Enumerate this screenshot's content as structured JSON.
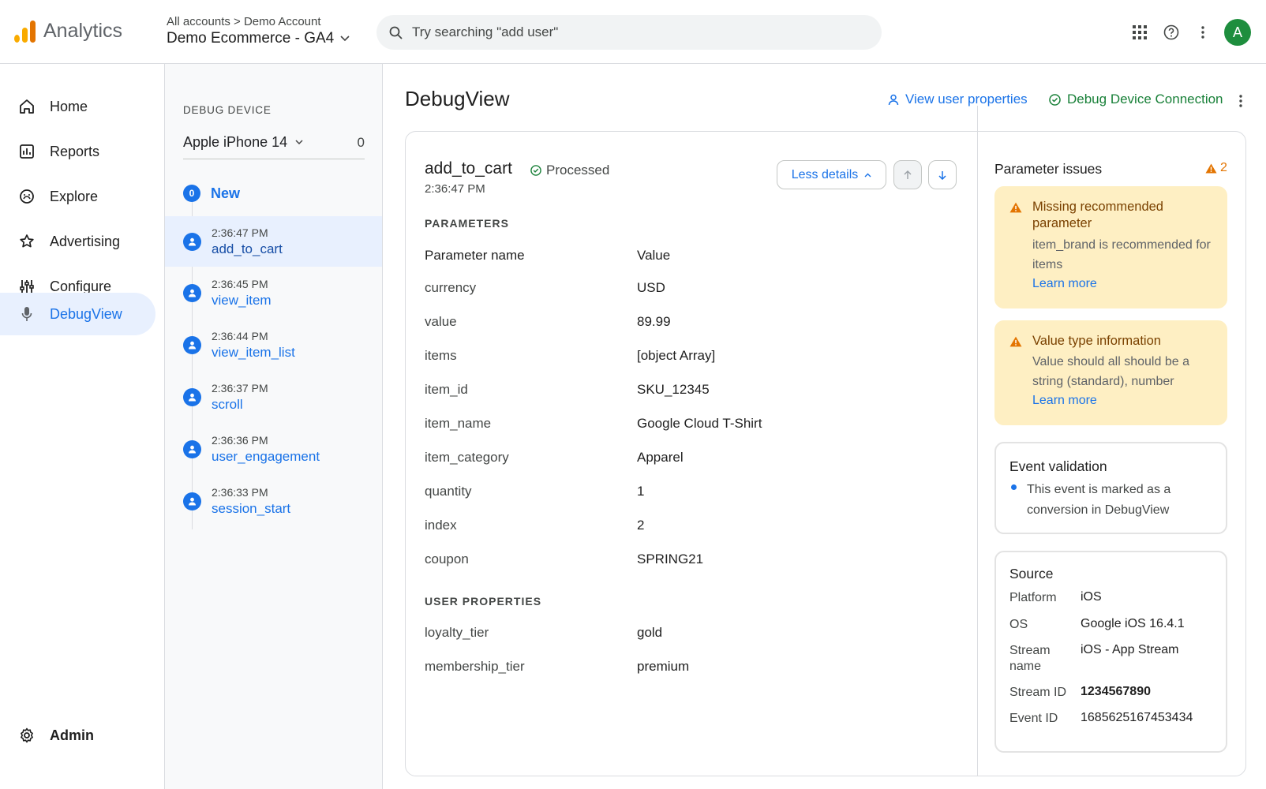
{
  "header": {
    "app_name": "Analytics",
    "breadcrumb": "All accounts > Demo Account",
    "property": "Demo Ecommerce - GA4",
    "search_placeholder": "Try searching \"add user\"",
    "avatar_letter": "A",
    "icons": [
      "apps-grid-icon",
      "help-icon",
      "more-vert-icon"
    ]
  },
  "nav": {
    "items": [
      {
        "label": "Home",
        "icon": "home-icon"
      },
      {
        "label": "Reports",
        "icon": "reports-icon"
      },
      {
        "label": "Explore",
        "icon": "explore-icon"
      },
      {
        "label": "Advertising",
        "icon": "advertising-icon"
      },
      {
        "label": "Configure",
        "icon": "configure-icon"
      },
      {
        "label": "DebugView",
        "icon": "debug-mic-icon",
        "active": true
      }
    ],
    "admin": {
      "label": "Admin",
      "icon": "gear-icon"
    }
  },
  "debug_device": {
    "label": "DEBUG DEVICE",
    "device": "Apple iPhone 14",
    "count": "0",
    "new_count": "0",
    "new_label": "New",
    "events": [
      {
        "time": "2:36:47 PM",
        "name": "add_to_cart",
        "selected": true
      },
      {
        "time": "2:36:45 PM",
        "name": "view_item"
      },
      {
        "time": "2:36:44 PM",
        "name": "view_item_list"
      },
      {
        "time": "2:36:37 PM",
        "name": "scroll"
      },
      {
        "time": "2:36:36 PM",
        "name": "user_engagement"
      },
      {
        "time": "2:36:33 PM",
        "name": "session_start"
      }
    ]
  },
  "main": {
    "title": "DebugView",
    "view_user_properties": "View user properties",
    "debug_device_connection": "Debug Device Connection",
    "event": {
      "name": "add_to_cart",
      "status": "Processed",
      "time": "2:36:47 PM",
      "less_details": "Less details"
    },
    "parameters_header": "PARAMETERS",
    "col_name": "Parameter name",
    "col_value": "Value",
    "parameters": [
      {
        "name": "currency",
        "value": "USD"
      },
      {
        "name": "value",
        "value": "89.99"
      },
      {
        "name": "items",
        "value": "[object Array]"
      },
      {
        "name": "item_id",
        "value": "SKU_12345"
      },
      {
        "name": "item_name",
        "value": "Google Cloud T-Shirt"
      },
      {
        "name": "item_category",
        "value": "Apparel"
      },
      {
        "name": "quantity",
        "value": "1"
      },
      {
        "name": "index",
        "value": "2"
      },
      {
        "name": "coupon",
        "value": "SPRING21"
      }
    ],
    "user_properties_header": "USER PROPERTIES",
    "user_properties": [
      {
        "name": "loyalty_tier",
        "value": "gold"
      },
      {
        "name": "membership_tier",
        "value": "premium"
      }
    ]
  },
  "issues": {
    "title": "Parameter issues",
    "count": "2",
    "warnings": [
      {
        "title": "Missing recommended parameter",
        "desc": "item_brand is recommended for items",
        "link": "Learn more"
      },
      {
        "title": "Value type information",
        "desc": "Value should all should be a string (standard), number",
        "link": "Learn more"
      }
    ],
    "validation": {
      "title": "Event validation",
      "text": "This event is marked as a conversion in DebugView"
    },
    "source": {
      "title": "Source",
      "rows": [
        {
          "key": "Platform",
          "value": "iOS"
        },
        {
          "key": "OS",
          "value": "Google iOS 16.4.1"
        },
        {
          "key": "Stream name",
          "value": "iOS - App Stream"
        },
        {
          "key": "Stream ID",
          "value": "1234567890"
        },
        {
          "key": "Event ID",
          "value": "1685625167453434"
        }
      ]
    }
  },
  "colors": {
    "accent": "#1a73e8",
    "success": "#188038",
    "warning": "#e37400",
    "warning_bg": "#feefc3"
  }
}
